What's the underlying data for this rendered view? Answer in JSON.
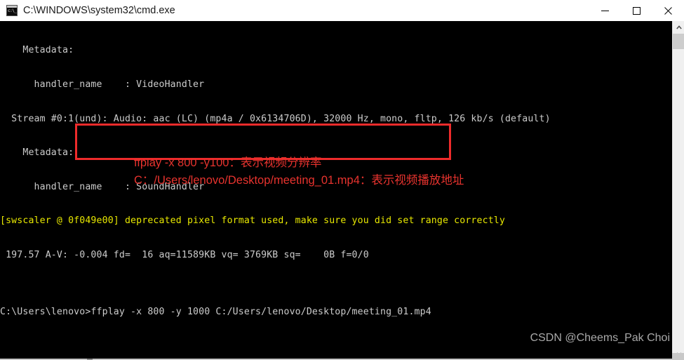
{
  "window": {
    "title": "C:\\WINDOWS\\system32\\cmd.exe",
    "icon": "cmd-icon",
    "controls": {
      "minimize": "Minimize",
      "maximize": "Maximize",
      "close": "Close"
    }
  },
  "console": {
    "background_color": "#000000",
    "text_color": "#cccccc",
    "warning_color": "#e8e800",
    "lines": [
      {
        "text": "    Metadata:",
        "color": "white"
      },
      {
        "text": "      handler_name    : VideoHandler",
        "color": "white"
      },
      {
        "text": "  Stream #0:1(und): Audio: aac (LC) (mp4a / 0x6134706D), 32000 Hz, mono, fltp, 126 kb/s (default)",
        "color": "white"
      },
      {
        "text": "    Metadata:",
        "color": "white"
      },
      {
        "text": "      handler_name    : SoundHandler",
        "color": "white"
      },
      {
        "text": "[swscaler @ 0f049e00] deprecated pixel format used, make sure you did set range correctly",
        "color": "yellow"
      },
      {
        "text": " 197.57 A-V: -0.004 fd=  16 aq=11589KB vq= 3769KB sq=    0B f=0/0",
        "color": "white"
      },
      {
        "text": "",
        "color": "white"
      },
      {
        "text": "C:\\Users\\lenovo>ffplay -x 800 -y 1000 C:/Users/lenovo/Desktop/meeting_01.mp4",
        "color": "white"
      }
    ],
    "prompt": "C:\\Users\\lenovo>",
    "command": "ffplay -x 800 -y 1000 C:/Users/lenovo/Desktop/meeting_01.mp4"
  },
  "annotations": {
    "box_color": "#ee2b2b",
    "text_color": "#e8332e",
    "line1": "ffplay -x 800 -y100：表示视频分辨率",
    "line2": "C：/Users/lenovo/Desktop/meeting_01.mp4：表示视频播放地址"
  },
  "watermark": {
    "text": "CSDN @Cheems_Pak Choi"
  },
  "scrollbar": {
    "up_arrow": "▲",
    "down_arrow": "▼"
  }
}
